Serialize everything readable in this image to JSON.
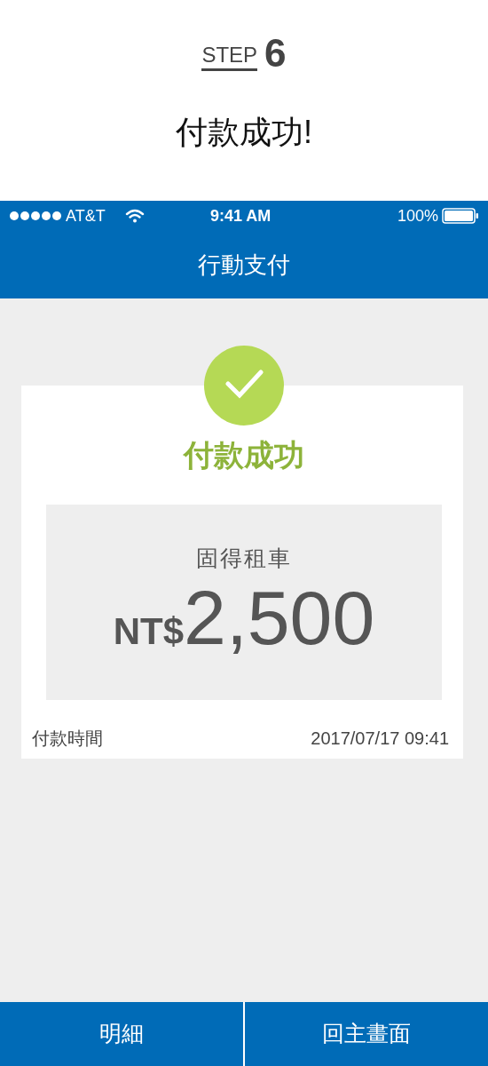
{
  "step": {
    "label": "STEP",
    "number": "6"
  },
  "heading": "付款成功!",
  "status_bar": {
    "carrier": "AT&T",
    "time": "9:41 AM",
    "battery": "100%"
  },
  "nav_bar": {
    "title": "行動支付"
  },
  "result": {
    "title": "付款成功",
    "merchant": "固得租車",
    "currency": "NT$",
    "amount": "2,500",
    "time_label": "付款時間",
    "time_value": "2017/07/17 09:41"
  },
  "buttons": [
    {
      "label": "明細"
    },
    {
      "label": "回主畫面"
    }
  ]
}
